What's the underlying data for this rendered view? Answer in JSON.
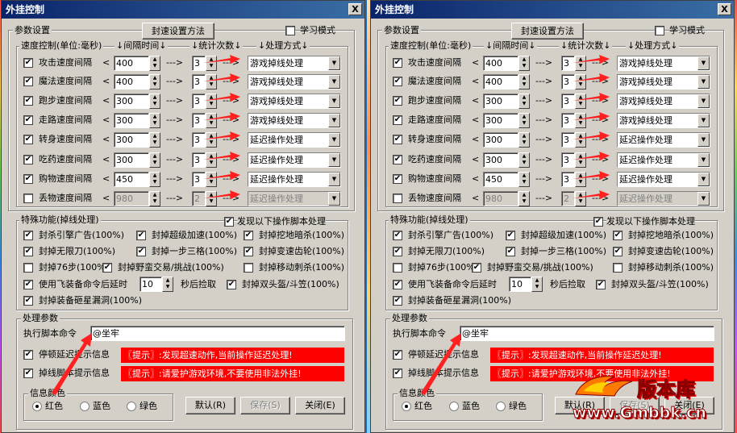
{
  "window": {
    "title": "外挂控制",
    "close_label": "X"
  },
  "params": {
    "group_label": "参数设置",
    "method_button": "封速设置方法",
    "learn_mode_label": "学习模式",
    "learn_mode_checked": false
  },
  "speed": {
    "group_label": "速度控制(单位:毫秒)",
    "col_interval": "↓间隔时间↓",
    "col_count": "↓统计次数↓",
    "col_action": "↓处理方式↓",
    "lt": "<",
    "flow": "--->",
    "rows": [
      {
        "label": "攻击速度间隔",
        "checked": true,
        "interval": "400",
        "count": "3",
        "action": "游戏掉线处理",
        "enabled": true
      },
      {
        "label": "魔法速度间隔",
        "checked": true,
        "interval": "400",
        "count": "3",
        "action": "游戏掉线处理",
        "enabled": true
      },
      {
        "label": "跑步速度间隔",
        "checked": true,
        "interval": "300",
        "count": "3",
        "action": "游戏掉线处理",
        "enabled": true
      },
      {
        "label": "走路速度间隔",
        "checked": true,
        "interval": "300",
        "count": "3",
        "action": "游戏掉线处理",
        "enabled": true
      },
      {
        "label": "转身速度间隔",
        "checked": true,
        "interval": "300",
        "count": "3",
        "action": "延迟操作处理",
        "enabled": true
      },
      {
        "label": "吃药速度间隔",
        "checked": true,
        "interval": "300",
        "count": "3",
        "action": "延迟操作处理",
        "enabled": true
      },
      {
        "label": "购物速度间隔",
        "checked": true,
        "interval": "450",
        "count": "3",
        "action": "延迟操作处理",
        "enabled": true
      },
      {
        "label": "丢物速度间隔",
        "checked": false,
        "interval": "980",
        "count": "2",
        "action": "延迟操作处理",
        "enabled": false
      }
    ]
  },
  "special": {
    "group_label": "特殊功能(掉线处理)",
    "script_label": "发现以下操作脚本处理",
    "script_checked": true,
    "items": [
      {
        "label": "封杀引擎广告(100%)",
        "checked": true
      },
      {
        "label": "封掉超级加速(100%)",
        "checked": true
      },
      {
        "label": "封掉挖地暗杀(100%)",
        "checked": true
      },
      {
        "label": "封掉无限刀(100%)",
        "checked": true
      },
      {
        "label": "封掉一步三格(100%)",
        "checked": true
      },
      {
        "label": "封掉变速齿轮(100%)",
        "checked": true
      },
      {
        "label": "封掉76步(100%)",
        "checked": false
      },
      {
        "label": "封掉野蛮交易/挑战(100%)",
        "checked": true
      },
      {
        "label": "封掉移动刺杀(100%)",
        "checked": false
      },
      {
        "label": "封掉双头盔/斗笠(100%)",
        "checked": true
      },
      {
        "label": "封掉装备砸星漏洞(100%)",
        "checked": true
      }
    ],
    "flying_equip": {
      "label_before": "使用飞装备命令后延时",
      "value": "10",
      "label_after": "秒后捡取",
      "checked": true
    }
  },
  "process": {
    "group_label": "处理参数",
    "script_cmd_label": "执行脚本命令",
    "script_cmd_value": "@坐牢",
    "stop_delay_label": "停顿延迟提示信息",
    "stop_delay_checked": true,
    "stop_delay_msg": "〖提示〗:发现超速动作,当前操作延迟处理!",
    "disconnect_label": "掉线脚本提示信息",
    "disconnect_checked": true,
    "disconnect_msg": "〖提示〗:请爱护游戏环境,不要使用非法外挂!"
  },
  "color": {
    "group_label": "信息颜色",
    "options": [
      "红色",
      "蓝色",
      "绿色"
    ],
    "selected": "红色"
  },
  "buttons": {
    "default": "默认(R)",
    "save": "保存(S)",
    "close": "关闭(E)"
  },
  "watermark": {
    "brand": "版本库",
    "url": "www.Gmbbk.cn"
  },
  "colors": {
    "titlebar": "#0a246a",
    "window_bg": "#d4d0c8",
    "warn_bg": "#ff0000",
    "arrow": "#ff2020"
  }
}
